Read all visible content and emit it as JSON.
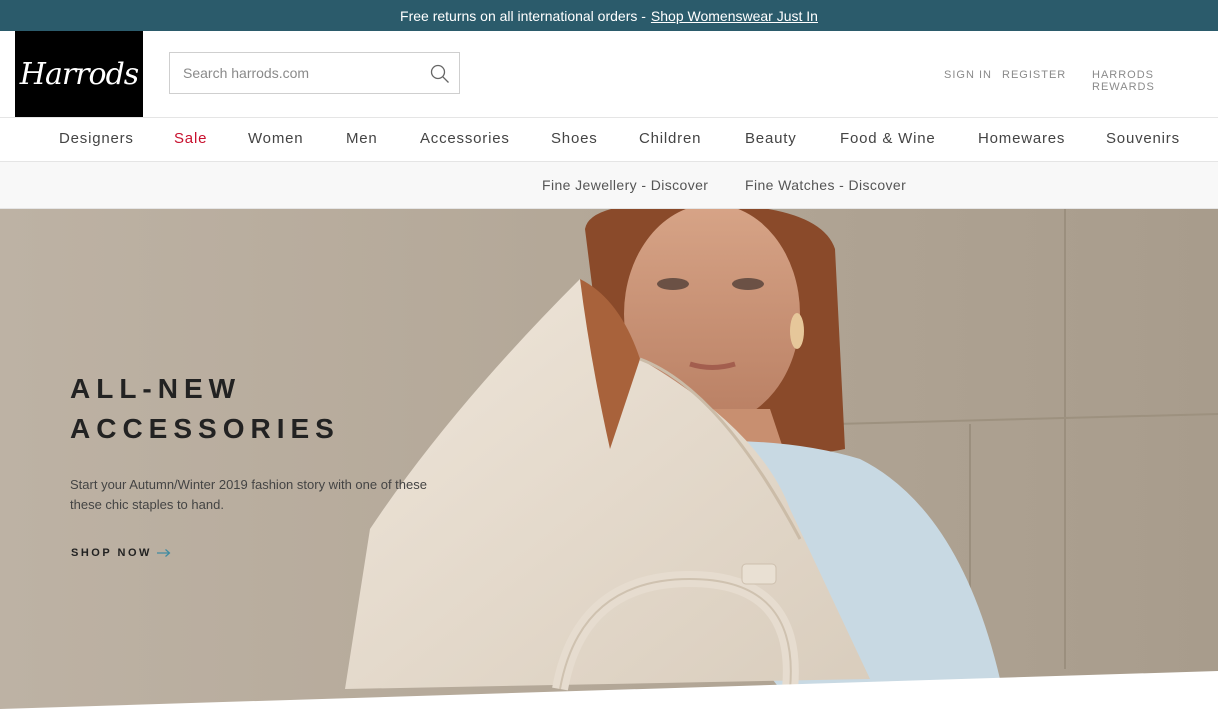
{
  "promo_bar": {
    "text": "Free returns on all international orders -",
    "link": "Shop Womenswear Just In"
  },
  "header": {
    "logo_text": "Harrods",
    "search": {
      "placeholder": "Search harrods.com",
      "value": ""
    },
    "account": {
      "sign_in": "SIGN IN",
      "register": "REGISTER",
      "rewards": "HARRODS REWARDS"
    }
  },
  "nav": {
    "items": [
      {
        "label": "Designers"
      },
      {
        "label": "Sale"
      },
      {
        "label": "Women"
      },
      {
        "label": "Men"
      },
      {
        "label": "Accessories"
      },
      {
        "label": "Shoes"
      },
      {
        "label": "Children"
      },
      {
        "label": "Beauty"
      },
      {
        "label": "Food & Wine"
      },
      {
        "label": "Homewares"
      },
      {
        "label": "Souvenirs"
      }
    ],
    "sale_color": "#c8102e"
  },
  "subnav": {
    "items": [
      {
        "label": "Fine Jewellery - Discover"
      },
      {
        "label": "Fine Watches - Discover"
      }
    ]
  },
  "hero": {
    "title": "ALL-NEW\nACCESSORIES",
    "description": "Start your Autumn/Winter 2019 fashion story with one of these these chic staples to hand.",
    "cta": "SHOP NOW",
    "arrow_icon": "arrow-right-icon"
  },
  "colors": {
    "promo_bg": "#2b5b6b",
    "logo_bg": "#000000"
  }
}
